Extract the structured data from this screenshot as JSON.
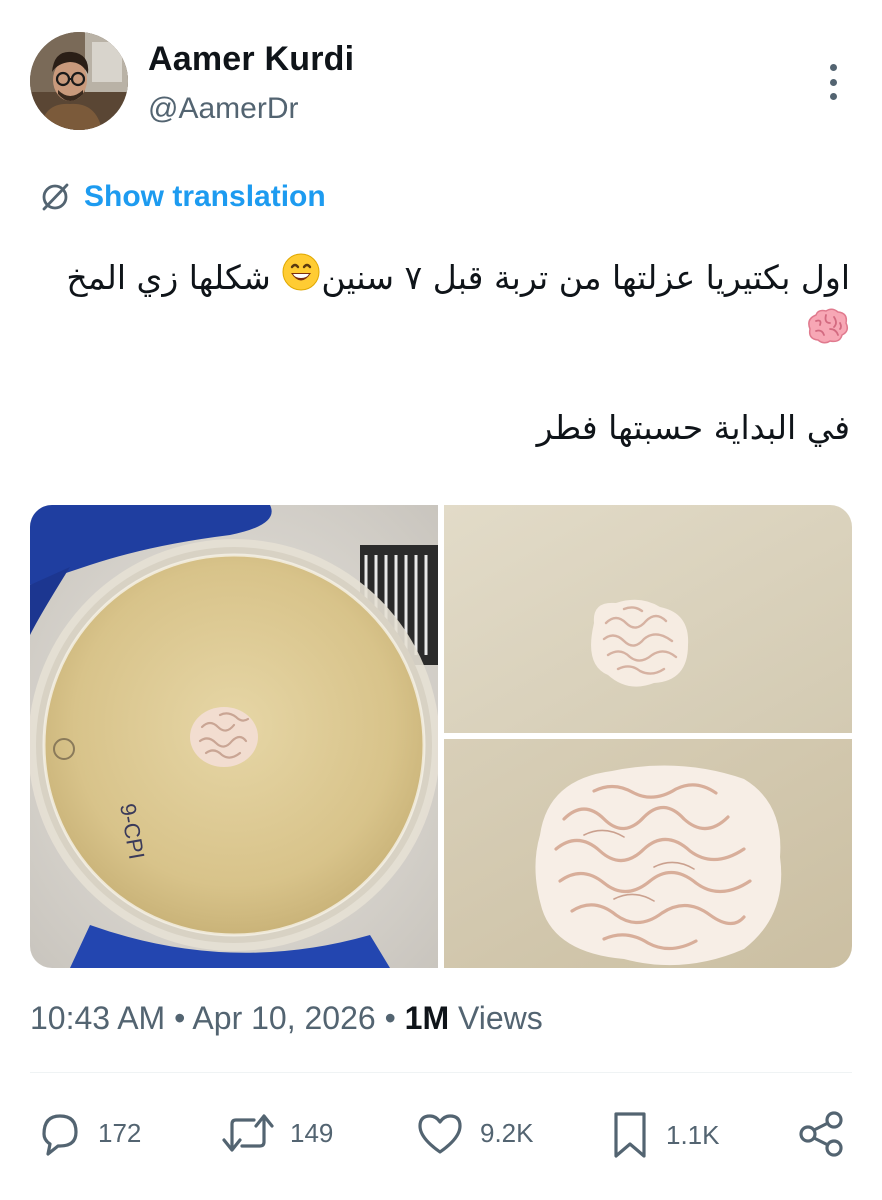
{
  "author": {
    "name": "Aamer Kurdi",
    "handle": "@AamerDr"
  },
  "translate": {
    "label": "Show translation"
  },
  "tweet": {
    "line1": "اول بكتيريا عزلتها من تربة قبل ٧ سنين",
    "line1b": " شكلها زي المخ ",
    "paragraph2": "في البداية حسبتها فطر",
    "emoji1": "grinning-face-smiling-eyes",
    "emoji2": "brain"
  },
  "media": {
    "dish_label": "9-CPI"
  },
  "meta": {
    "time": "10:43 AM",
    "sep1": " • ",
    "date": "Apr 10, 2026",
    "sep2": " • ",
    "views_count": "1M",
    "views_label": " Views"
  },
  "actions": {
    "replies": "172",
    "reposts": "149",
    "likes": "9.2K",
    "bookmarks": "1.1K"
  },
  "icons": [
    "translate-icon",
    "more-icon",
    "reply-icon",
    "repost-icon",
    "like-icon",
    "bookmark-icon",
    "share-icon"
  ],
  "colors": {
    "accent": "#1d9bf0",
    "text": "#0f1419",
    "secondary": "#536471"
  }
}
